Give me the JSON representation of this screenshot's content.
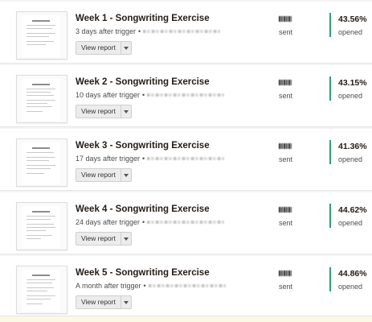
{
  "emails": [
    {
      "title": "Week 1 - Songwriting Exercise",
      "delay": "3 days after trigger",
      "separator": "•",
      "view_report_label": "View report",
      "sent_label": "sent",
      "open_rate": "43.56%",
      "opened_label": "opened"
    },
    {
      "title": "Week 2 - Songwriting Exercise",
      "delay": "10 days after trigger",
      "separator": "•",
      "view_report_label": "View report",
      "sent_label": "sent",
      "open_rate": "43.15%",
      "opened_label": "opened"
    },
    {
      "title": "Week 3 - Songwriting Exercise",
      "delay": "17 days after trigger",
      "separator": "•",
      "view_report_label": "View report",
      "sent_label": "sent",
      "open_rate": "41.36%",
      "opened_label": "opened"
    },
    {
      "title": "Week 4 - Songwriting Exercise",
      "delay": "24 days after trigger",
      "separator": "•",
      "view_report_label": "View report",
      "sent_label": "sent",
      "open_rate": "44.62%",
      "opened_label": "opened"
    },
    {
      "title": "Week 5 - Songwriting Exercise",
      "delay": "A month after trigger",
      "separator": "•",
      "view_report_label": "View report",
      "sent_label": "sent",
      "open_rate": "44.86%",
      "opened_label": "opened"
    }
  ],
  "colors": {
    "accent_bar": "#2ea06f",
    "text_primary": "#241c15",
    "text_secondary": "#4d4d4d"
  },
  "icons": {
    "dropdown": "chevron-down-icon"
  }
}
